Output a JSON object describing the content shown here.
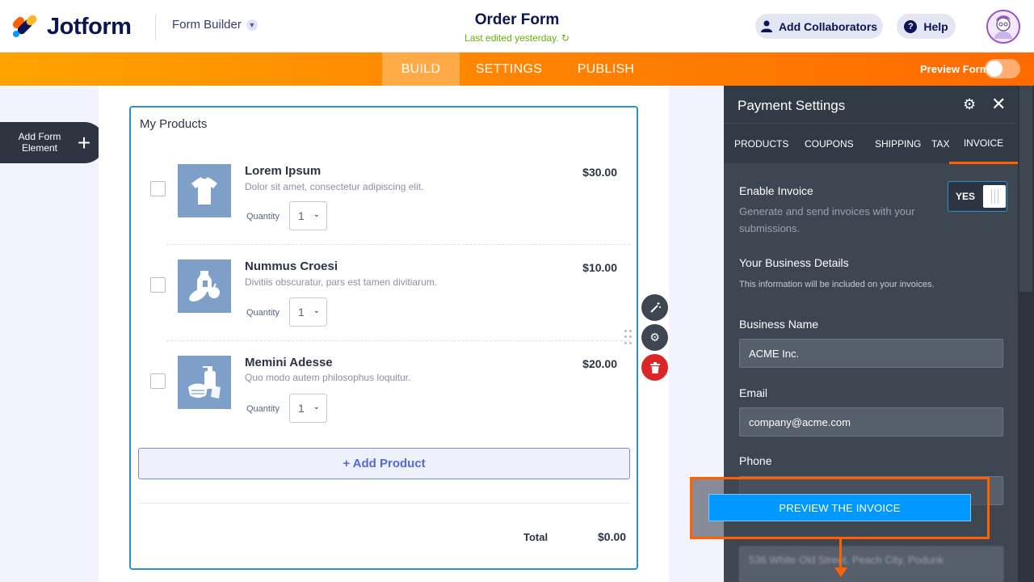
{
  "header": {
    "logo_text": "Jotform",
    "builder_label": "Form Builder",
    "form_title": "Order Form",
    "last_edited": "Last edited yesterday.",
    "add_collaborators": "Add Collaborators",
    "help": "Help"
  },
  "nav": {
    "tabs": [
      {
        "label": "BUILD",
        "active": true
      },
      {
        "label": "SETTINGS",
        "active": false
      },
      {
        "label": "PUBLISH",
        "active": false
      }
    ],
    "preview_form": "Preview Form"
  },
  "left": {
    "add_form_element": "Add Form Element"
  },
  "form": {
    "products_title": "My Products",
    "products": [
      {
        "name": "Lorem Ipsum",
        "description": "Dolor sit amet, consectetur adipiscing elit.",
        "price": "$30.00",
        "quantity_label": "Quantity",
        "quantity": "1",
        "icon": "tshirt-icon"
      },
      {
        "name": "Nummus Croesi",
        "description": "Divitiis obscuratur, pars est tamen divitiarum.",
        "price": "$10.00",
        "quantity_label": "Quantity",
        "quantity": "1",
        "icon": "groceries-icon"
      },
      {
        "name": "Memini Adesse",
        "description": "Quo modo autem philosophus loquitur.",
        "price": "$20.00",
        "quantity_label": "Quantity",
        "quantity": "1",
        "icon": "hygiene-icon"
      }
    ],
    "add_product": "+ Add Product",
    "total_label": "Total",
    "total_value": "$0.00"
  },
  "panel": {
    "title": "Payment Settings",
    "tabs": [
      "PRODUCTS",
      "COUPONS",
      "SHIPPING",
      "TAX",
      "INVOICE"
    ],
    "active_tab": "INVOICE",
    "enable_invoice_label": "Enable Invoice",
    "enable_invoice_help": "Generate and send invoices with your submissions.",
    "enable_invoice_value": "YES",
    "business_details_label": "Your Business Details",
    "business_details_help": "This information will be included on your invoices.",
    "business_name_label": "Business Name",
    "business_name_value": "ACME Inc.",
    "email_label": "Email",
    "email_value": "company@acme.com",
    "phone_label": "Phone",
    "address_value": "536 White Old Street, Peach City, Podunk"
  },
  "callout": {
    "preview_invoice": "PREVIEW THE INVOICE"
  },
  "colors": {
    "brand_orange": "#ff6100",
    "accent_blue": "#0099ff",
    "panel_bg": "#3e4652"
  }
}
